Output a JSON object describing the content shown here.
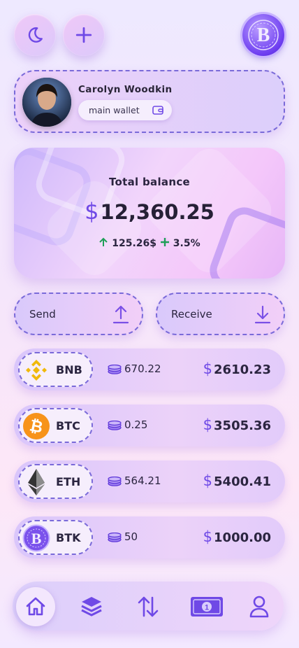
{
  "header": {
    "theme_icon": "moon-icon",
    "add_icon": "plus-icon",
    "logo_letter": "B"
  },
  "profile": {
    "name": "Carolyn Woodkin",
    "wallet_label": "main wallet",
    "wallet_icon": "wallet-icon"
  },
  "balance": {
    "title": "Total balance",
    "currency_symbol": "$",
    "amount": "12,360.25",
    "change_amount": "125.26$",
    "change_percent": "3.5%"
  },
  "actions": {
    "send_label": "Send",
    "receive_label": "Receive"
  },
  "coins": [
    {
      "symbol": "BNB",
      "quantity": "670.22",
      "currency": "$",
      "value": "2610.23",
      "icon": "binance-icon"
    },
    {
      "symbol": "BTC",
      "quantity": "0.25",
      "currency": "$",
      "value": "3505.36",
      "icon": "bitcoin-icon"
    },
    {
      "symbol": "ETH",
      "quantity": "564.21",
      "currency": "$",
      "value": "5400.41",
      "icon": "ethereum-icon"
    },
    {
      "symbol": "BTK",
      "quantity": "50",
      "currency": "$",
      "value": "1000.00",
      "icon": "btk-logo-icon"
    }
  ],
  "nav": {
    "items": [
      "home-icon",
      "layers-icon",
      "transfer-icon",
      "banknote-icon",
      "user-icon"
    ],
    "active": "home-icon"
  },
  "colors": {
    "accent": "#6f49e6",
    "positive": "#1e9e57",
    "border_dash": "#7a6ad9"
  }
}
